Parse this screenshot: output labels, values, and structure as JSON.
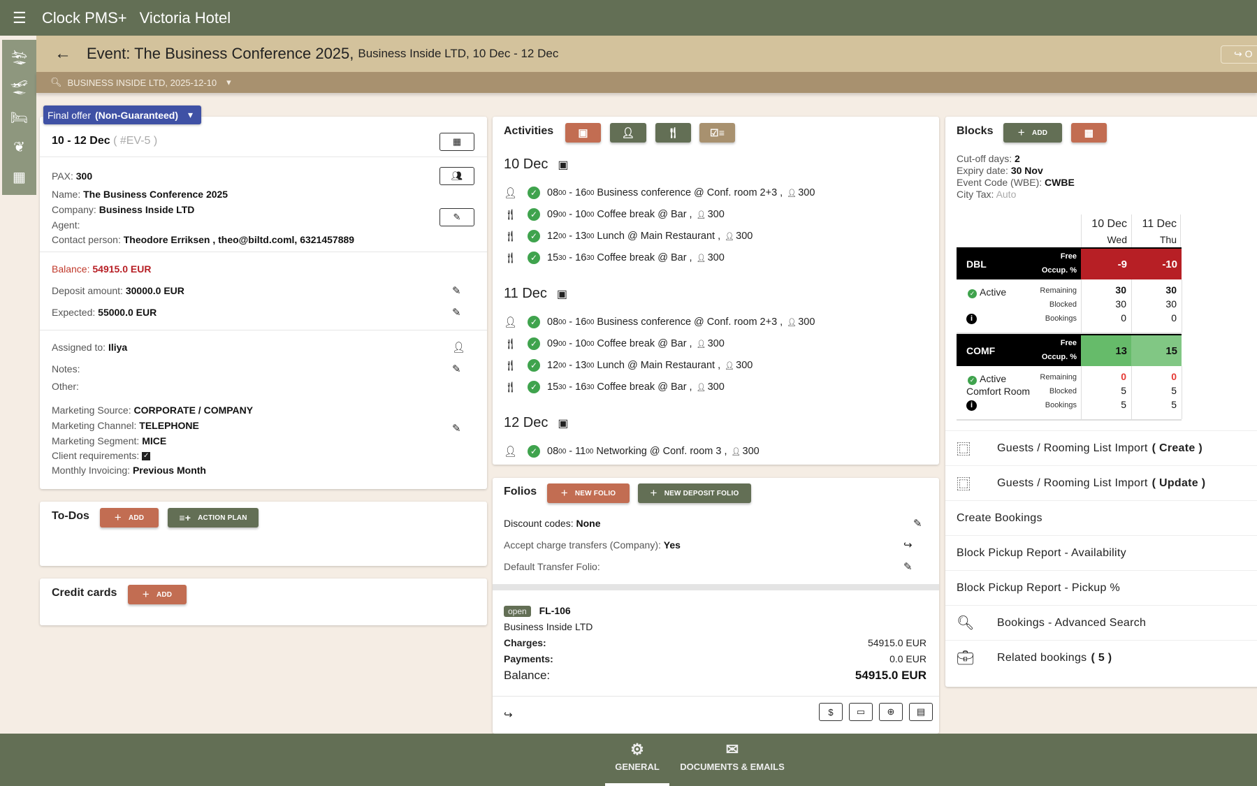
{
  "app": {
    "name": "Clock PMS+",
    "hotel": "Victoria Hotel"
  },
  "header": {
    "title": "Event: The Business Conference 2025,",
    "subtitle": "Business Inside LTD, 10 Dec - 12 Dec",
    "share_label": "O"
  },
  "search": {
    "value": "BUSINESS INSIDE LTD, 2025-12-10"
  },
  "status_chip": {
    "label": "Final offer",
    "value": "(Non-Guaranteed)"
  },
  "details": {
    "dates": "10 - 12 Dec",
    "code": "( #EV-5 )",
    "pax_label": "PAX:",
    "pax": "300",
    "name_label": "Name:",
    "name": "The Business Conference 2025",
    "company_label": "Company:",
    "company": "Business Inside LTD",
    "agent_label": "Agent:",
    "contact_label": "Contact person:",
    "contact": "Theodore Erriksen , theo@biltd.coml, 6321457889",
    "balance_label": "Balance:",
    "balance": "54915.0 EUR",
    "deposit_label": "Deposit amount:",
    "deposit": "30000.0 EUR",
    "expected_label": "Expected:",
    "expected": "55000.0 EUR",
    "assigned_label": "Assigned to:",
    "assigned": "Iliya",
    "notes_label": "Notes:",
    "other_label": "Other:",
    "msource_label": "Marketing Source:",
    "msource": "CORPORATE / COMPANY",
    "mchannel_label": "Marketing Channel:",
    "mchannel": "TELEPHONE",
    "msegment_label": "Marketing Segment:",
    "msegment": "MICE",
    "client_req_label": "Client requirements:",
    "client_req_checked": true,
    "invoicing_label": "Monthly Invoicing:",
    "invoicing": "Previous Month"
  },
  "todos": {
    "title": "To-Dos",
    "add": "ADD",
    "action_plan": "ACTION PLAN"
  },
  "credit_cards": {
    "title": "Credit cards",
    "add": "ADD"
  },
  "activities": {
    "title": "Activities",
    "days": [
      {
        "label": "10 Dec",
        "items": [
          {
            "type": "conference",
            "start": "08",
            "start_min": "00",
            "end": "16",
            "end_min": "00",
            "text": "Business conference @ Conf. room 2+3 ,",
            "pax": "300"
          },
          {
            "type": "food",
            "start": "09",
            "start_min": "00",
            "end": "10",
            "end_min": "00",
            "text": "Coffee break @ Bar ,",
            "pax": "300"
          },
          {
            "type": "food",
            "start": "12",
            "start_min": "00",
            "end": "13",
            "end_min": "00",
            "text": "Lunch @ Main Restaurant ,",
            "pax": "300"
          },
          {
            "type": "food",
            "start": "15",
            "start_min": "30",
            "end": "16",
            "end_min": "30",
            "text": "Coffee break @ Bar ,",
            "pax": "300"
          }
        ]
      },
      {
        "label": "11 Dec",
        "items": [
          {
            "type": "conference",
            "start": "08",
            "start_min": "00",
            "end": "16",
            "end_min": "00",
            "text": "Business conference @ Conf. room 2+3 ,",
            "pax": "300"
          },
          {
            "type": "food",
            "start": "09",
            "start_min": "00",
            "end": "10",
            "end_min": "00",
            "text": "Coffee break @ Bar ,",
            "pax": "300"
          },
          {
            "type": "food",
            "start": "12",
            "start_min": "00",
            "end": "13",
            "end_min": "00",
            "text": "Lunch @ Main Restaurant ,",
            "pax": "300"
          },
          {
            "type": "food",
            "start": "15",
            "start_min": "30",
            "end": "16",
            "end_min": "30",
            "text": "Coffee break @ Bar ,",
            "pax": "300"
          }
        ]
      },
      {
        "label": "12 Dec",
        "items": [
          {
            "type": "conference",
            "start": "08",
            "start_min": "00",
            "end": "11",
            "end_min": "00",
            "text": "Networking @ Conf. room 3 ,",
            "pax": "300"
          }
        ]
      }
    ]
  },
  "folios": {
    "title": "Folios",
    "new_folio": "NEW FOLIO",
    "new_deposit_folio": "NEW DEPOSIT FOLIO",
    "discount_label": "Discount codes:",
    "discount": "None",
    "transfers_label": "Accept charge transfers (Company):",
    "transfers": "Yes",
    "default_transfer_label": "Default Transfer Folio:",
    "folio": {
      "status": "open",
      "number": "FL-106",
      "company": "Business Inside LTD",
      "charges_label": "Charges:",
      "charges": "54915.0 EUR",
      "payments_label": "Payments:",
      "payments": "0.0 EUR",
      "balance_label": "Balance:",
      "balance": "54915.0 EUR"
    }
  },
  "blocks": {
    "title": "Blocks",
    "add": "ADD",
    "cutoff_label": "Cut-off days:",
    "cutoff": "2",
    "expiry_label": "Expiry date:",
    "expiry": "30 Nov",
    "code_label": "Event Code (WBE):",
    "code": "CWBE",
    "tax_label": "City Tax:",
    "tax": "Auto",
    "columns": [
      {
        "date": "10 Dec",
        "dow": "Wed"
      },
      {
        "date": "11 Dec",
        "dow": "Thu"
      }
    ],
    "free_label": "Free",
    "occup_label": "Occup. %",
    "remaining_label": "Remaining",
    "blocked_label": "Blocked",
    "bookings_label": "Bookings",
    "rooms": [
      {
        "code": "DBL",
        "status": "Active",
        "name": "",
        "free": [
          "-9",
          "-10"
        ],
        "remaining": [
          "30",
          "30"
        ],
        "blocked": [
          "30",
          "30"
        ],
        "bookings": [
          "0",
          "0"
        ],
        "colors": [
          "#b71f25",
          "#b71f25"
        ]
      },
      {
        "code": "COMF",
        "status": "Active",
        "name": "Comfort Room",
        "free": [
          "13",
          "15"
        ],
        "remaining": [
          "0",
          "0"
        ],
        "blocked": [
          "5",
          "5"
        ],
        "bookings": [
          "5",
          "5"
        ],
        "colors": [
          "#66bb6a",
          "#81c784"
        ]
      }
    ]
  },
  "actions": [
    {
      "icon": "document-scan",
      "label": "Guests / Rooming List Import",
      "bold": "( Create )"
    },
    {
      "icon": "document-scan",
      "label": "Guests / Rooming List Import",
      "bold": "( Update )"
    },
    {
      "icon": "",
      "label": "Create Bookings",
      "bold": ""
    },
    {
      "icon": "",
      "label": "Block Pickup Report - Availability",
      "bold": ""
    },
    {
      "icon": "",
      "label": "Block Pickup Report - Pickup %",
      "bold": ""
    },
    {
      "icon": "search",
      "label": "Bookings - Advanced Search",
      "bold": ""
    },
    {
      "icon": "briefcase",
      "label": "Related bookings",
      "bold": "( 5 )"
    }
  ],
  "bottom_tabs": [
    {
      "label": "GENERAL",
      "active": true
    },
    {
      "label": "DOCUMENTS & EMAILS",
      "active": false
    }
  ]
}
